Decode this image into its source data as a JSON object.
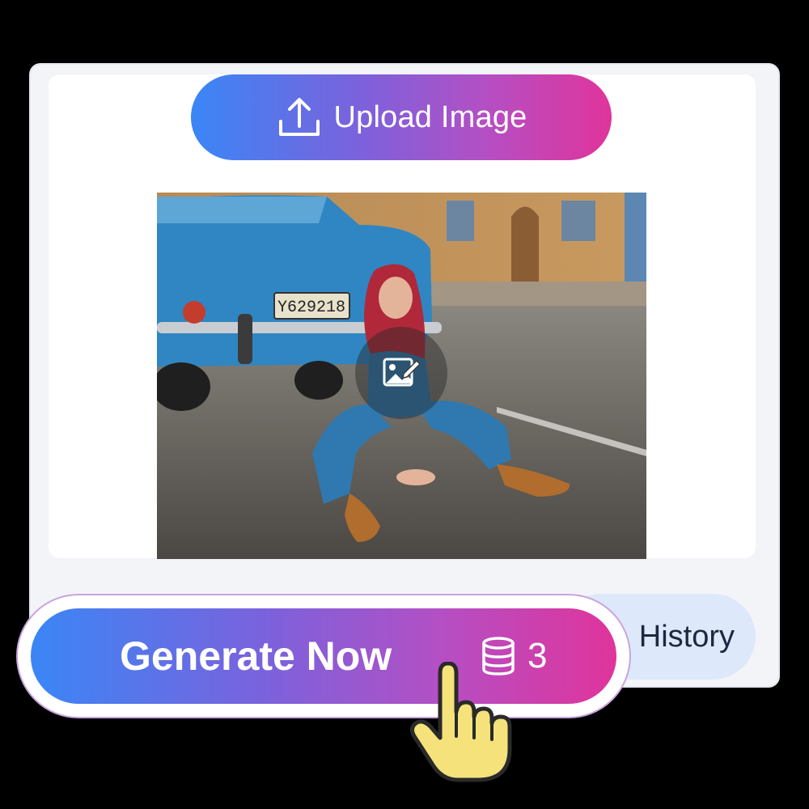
{
  "upload": {
    "label": "Upload Image",
    "icon": "upload-icon"
  },
  "preview": {
    "license_plate": "Y629218",
    "edit_icon": "image-edit-icon"
  },
  "history": {
    "label": "History"
  },
  "generate": {
    "label": "Generate Now",
    "credits_icon": "database-icon",
    "credits": "3"
  },
  "cursor": {
    "icon": "hand-pointer-icon"
  },
  "colors": {
    "gradient_start": "#3a86f6",
    "gradient_end": "#e0349b",
    "history_bg": "#dde9fb",
    "cursor_fill": "#f5e27a"
  }
}
